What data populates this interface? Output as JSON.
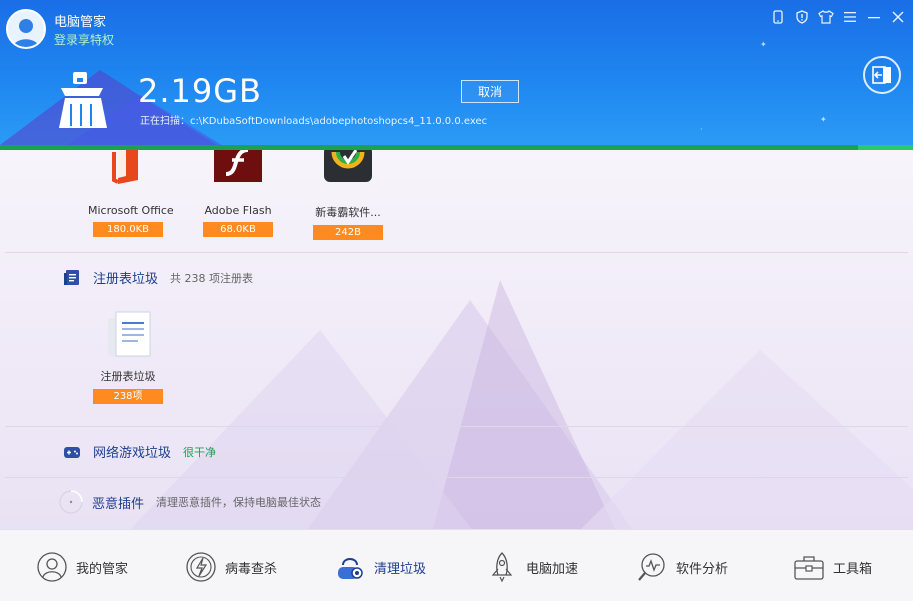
{
  "header": {
    "app_title": "电脑管家",
    "login_text": "登录享特权",
    "scan_size": "2.19GB",
    "scan_path": "正在扫描：c:\\KDubaSoftDownloads\\adobephotoshopcs4_11.0.0.0.exec",
    "cancel_label": "取消",
    "progress_fraction": 0.94
  },
  "colors": {
    "accent": "#1f86f0",
    "progress": "#2dc86b",
    "badge": "#ff8a1f",
    "title_blue": "#1e3f8f"
  },
  "software_items": [
    {
      "label": "Microsoft Office",
      "size": "180.0KB"
    },
    {
      "label": "Adobe Flash",
      "size": "68.0KB"
    },
    {
      "label": "新毒霸软件...",
      "size": "242B"
    }
  ],
  "registry": {
    "title": "注册表垃圾",
    "summary": "共 238 项注册表",
    "item_label": "注册表垃圾",
    "item_count": "238项"
  },
  "game": {
    "title": "网络游戏垃圾",
    "status": "很干净"
  },
  "plugin": {
    "title": "恶意插件",
    "desc": "清理恶意插件，保持电脑最佳状态"
  },
  "nav": [
    {
      "label": "我的管家",
      "icon": "butler-icon"
    },
    {
      "label": "病毒查杀",
      "icon": "antivirus-icon"
    },
    {
      "label": "清理垃圾",
      "icon": "vacuum-cleaner-icon",
      "active": true
    },
    {
      "label": "电脑加速",
      "icon": "rocket-icon"
    },
    {
      "label": "软件分析",
      "icon": "analysis-icon"
    },
    {
      "label": "工具箱",
      "icon": "toolbox-icon"
    }
  ]
}
